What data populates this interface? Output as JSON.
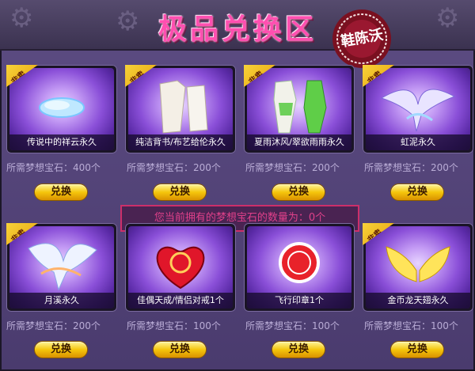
{
  "page": {
    "title": "极品兑换区",
    "seal_text": "鞋陈沃",
    "notice": "您当前拥有的梦想宝石的数量为：0个"
  },
  "items": [
    {
      "name": "传说中的祥云永久",
      "price": "所需梦想宝石：400个",
      "button": "兑换",
      "badge": "非卖",
      "icon": "cloud-icon"
    },
    {
      "name": "纯洁背书/布艺给伦永久",
      "price": "所需梦想宝石：200个",
      "button": "兑换",
      "badge": "非卖",
      "icon": "dress-icon"
    },
    {
      "name": "夏雨沐风/翠欲雨雨永久",
      "price": "所需梦想宝石：200个",
      "button": "兑换",
      "badge": "非卖",
      "icon": "green-outfit-icon"
    },
    {
      "name": "虹泥永久",
      "price": "所需梦想宝石：200个",
      "button": "兑换",
      "badge": "非卖",
      "icon": "phoenix-icon"
    },
    {
      "name": "月溪永久",
      "price": "所需梦想宝石：200个",
      "button": "兑换",
      "badge": "非卖",
      "icon": "winged-horse-icon"
    },
    {
      "name": "佳偶天成/情侣对戒1个",
      "price": "所需梦想宝石：100个",
      "button": "兑换",
      "badge": "",
      "icon": "heart-ring-icon"
    },
    {
      "name": "飞行印章1个",
      "price": "所需梦想宝石：100个",
      "button": "兑换",
      "badge": "",
      "icon": "fly-stamp-icon"
    },
    {
      "name": "金币龙天翅永久",
      "price": "所需梦想宝石：100个",
      "button": "兑换",
      "badge": "非卖",
      "icon": "golden-wings-icon"
    }
  ]
}
